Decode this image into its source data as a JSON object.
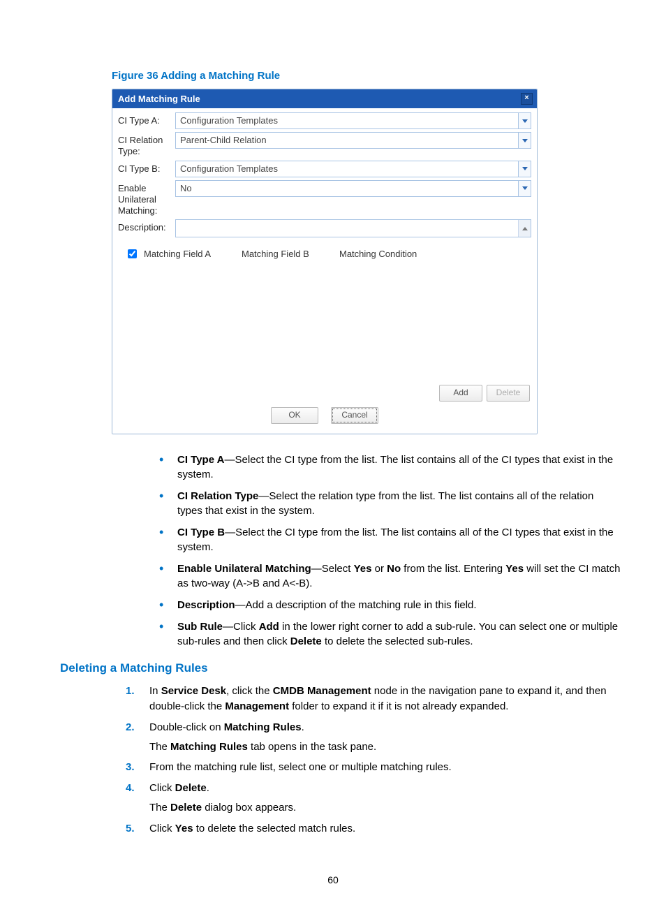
{
  "figure_caption": "Figure 36  Adding a Matching Rule",
  "dialog": {
    "title": "Add Matching Rule",
    "fields": {
      "ci_type_a_label": "CI Type A:",
      "ci_type_a_value": "Configuration Templates",
      "ci_relation_label": "CI Relation Type:",
      "ci_relation_value": "Parent-Child Relation",
      "ci_type_b_label": "CI Type B:",
      "ci_type_b_value": "Configuration Templates",
      "unilateral_label": "Enable Unilateral Matching:",
      "unilateral_value": "No",
      "description_label": "Description:"
    },
    "grid": {
      "col_a": "Matching Field A",
      "col_b": "Matching Field B",
      "col_c": "Matching Condition"
    },
    "buttons": {
      "add": "Add",
      "delete": "Delete",
      "ok": "OK",
      "cancel": "Cancel"
    }
  },
  "bullets": [
    {
      "term": "CI Type A",
      "text": "—Select the CI type from the list. The list contains all of the CI types that exist in the system."
    },
    {
      "term": "CI Relation Type",
      "text": "—Select the relation type from the list. The list contains all of the relation types that exist in the system."
    },
    {
      "term": "CI Type B",
      "text": "—Select the CI type from the list. The list contains all of the CI types that exist in the system."
    },
    {
      "term": "Enable Unilateral Matching",
      "text_pre": "—Select ",
      "yes": "Yes",
      "text_mid": " or ",
      "no": "No",
      "text_mid2": " from the list. Entering ",
      "yes2": "Yes",
      "text_post": " will set the CI match as two-way (A->B and A<-B)."
    },
    {
      "term": "Description",
      "text": "—Add a description of the matching rule in this field."
    },
    {
      "term": "Sub Rule",
      "text_pre": "—Click ",
      "add": "Add",
      "text_mid": " in the lower right corner to add a sub-rule. You can select one or multiple sub-rules and then click ",
      "delete": "Delete",
      "text_post": " to delete the selected sub-rules."
    }
  ],
  "section2_title": "Deleting a Matching Rules",
  "steps": [
    {
      "num": "1.",
      "html": "In <b>Service Desk</b>, click the <b>CMDB Management</b> node in the navigation pane to expand it, and then double-click the <b>Management</b> folder to expand it if it is not already expanded."
    },
    {
      "num": "2.",
      "html": "Double-click on <b>Matching Rules</b>.",
      "sub": "The <b>Matching Rules</b> tab opens in the task pane."
    },
    {
      "num": "3.",
      "html": "From the matching rule list, select one or multiple matching rules."
    },
    {
      "num": "4.",
      "html": "Click <b>Delete</b>.",
      "sub": "The <b>Delete</b> dialog box appears."
    },
    {
      "num": "5.",
      "html": "Click <b>Yes</b> to delete the selected match rules."
    }
  ],
  "page_number": "60"
}
